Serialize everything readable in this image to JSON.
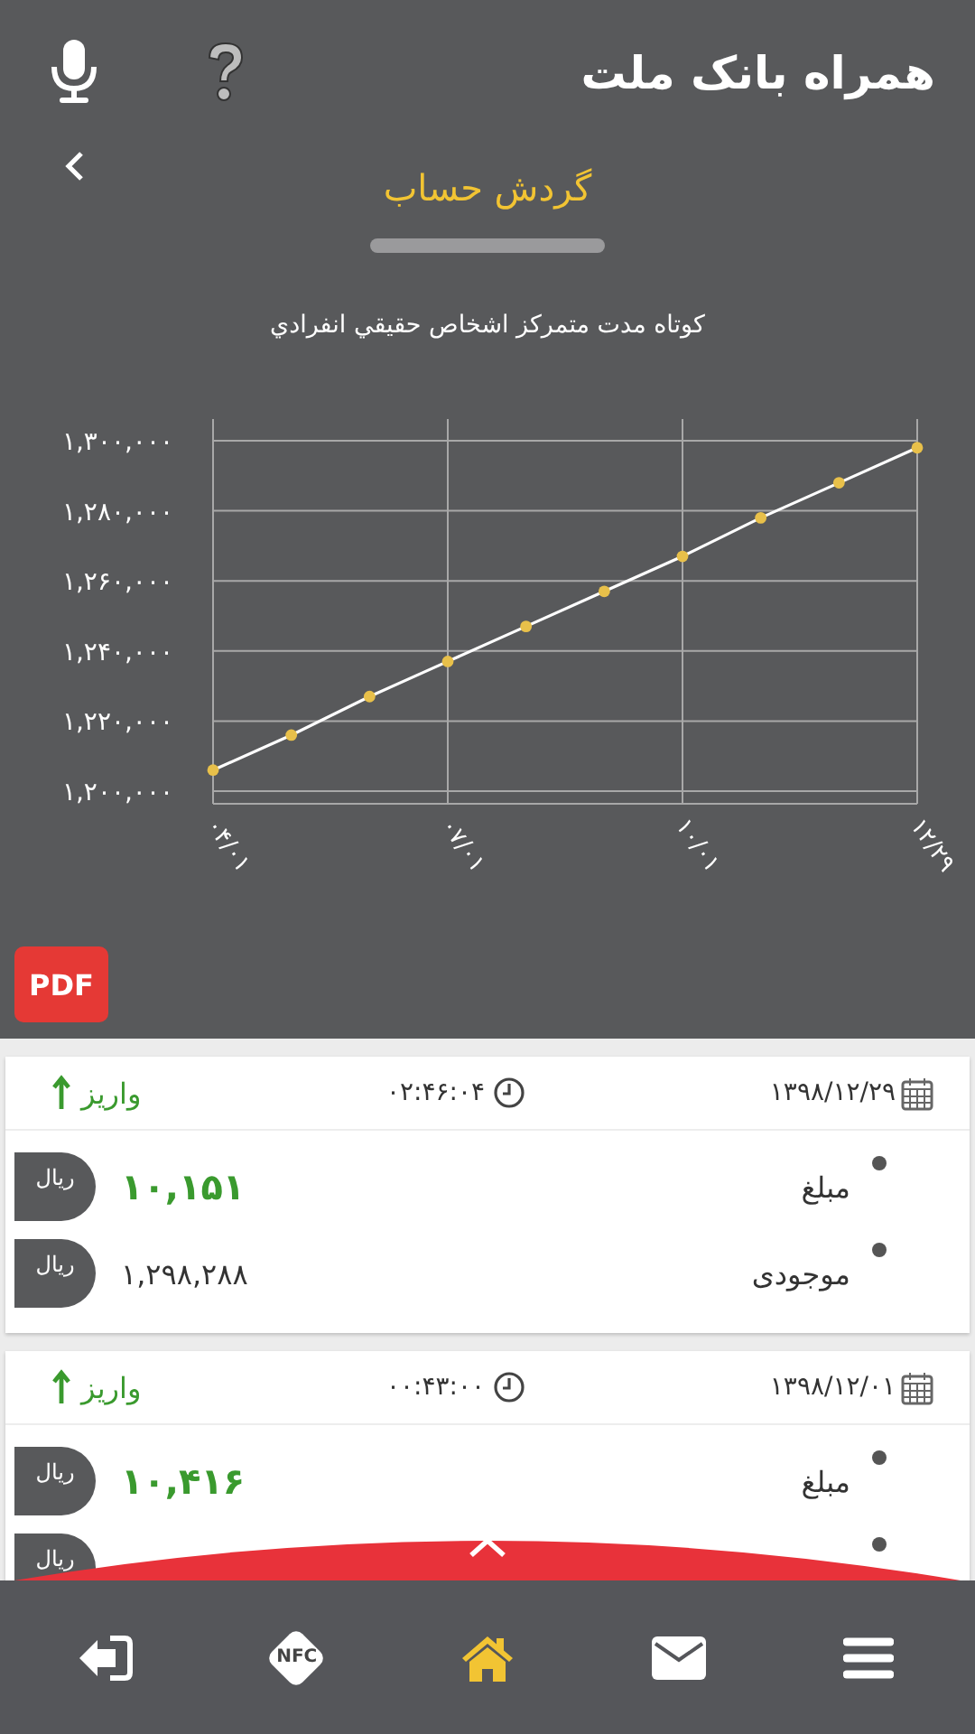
{
  "app_bar": {
    "title": "همراه بانک ملت"
  },
  "page": {
    "title": "گردش حساب",
    "account_type": "کوتاه مدت متمرکز اشخاص حقيقي انفرادي"
  },
  "chart_data": {
    "type": "line",
    "categories": [
      "۰۴/۰۱",
      null,
      null,
      "۰۷/۰۱",
      null,
      null,
      "۱۰/۰۱",
      null,
      null,
      "۱۲/۲۹"
    ],
    "grid": true,
    "series": [
      {
        "color": "#e8c04a",
        "marker": true,
        "values": [
          1206000,
          1216000,
          1227000,
          1237000,
          1247000,
          1257000,
          1267000,
          1278000,
          1288000,
          1298000
        ]
      }
    ],
    "ylim": [
      1200000,
      1300000
    ],
    "yticks": [
      {
        "value": 1200000,
        "label": "۱,۲۰۰,۰۰۰"
      },
      {
        "value": 1220000,
        "label": "۱,۲۲۰,۰۰۰"
      },
      {
        "value": 1240000,
        "label": "۱,۲۴۰,۰۰۰"
      },
      {
        "value": 1260000,
        "label": "۱,۲۶۰,۰۰۰"
      },
      {
        "value": 1280000,
        "label": "۱,۲۸۰,۰۰۰"
      },
      {
        "value": 1300000,
        "label": "۱,۳۰۰,۰۰۰"
      }
    ]
  },
  "pdf_button": "PDF",
  "transactions": [
    {
      "date": "۱۳۹۸/۱۲/۲۹",
      "time": "۰۲:۴۶:۰۴",
      "type": "واریز",
      "incoming": true,
      "rows": [
        {
          "kind": "amount",
          "label": "مبلغ",
          "value": "۱۰,۱۵۱",
          "unit": "ریال"
        },
        {
          "kind": "balance",
          "label": "موجودی",
          "value": "۱,۲۹۸,۲۸۸",
          "unit": "ریال"
        }
      ]
    },
    {
      "date": "۱۳۹۸/۱۲/۰۱",
      "time": "۰۰:۴۳:۰۰",
      "type": "واریز",
      "incoming": true,
      "rows": [
        {
          "kind": "amount",
          "label": "مبلغ",
          "value": "۱۰,۴۱۶",
          "unit": "ریال"
        },
        {
          "kind": "balance",
          "unit": "ریال"
        }
      ]
    }
  ],
  "nav": [
    {
      "kind": "logout",
      "selected": false
    },
    {
      "kind": "nfc",
      "label": "NFC",
      "selected": false
    },
    {
      "kind": "home",
      "selected": true
    },
    {
      "kind": "mail",
      "selected": false
    },
    {
      "kind": "menu",
      "selected": false
    }
  ]
}
